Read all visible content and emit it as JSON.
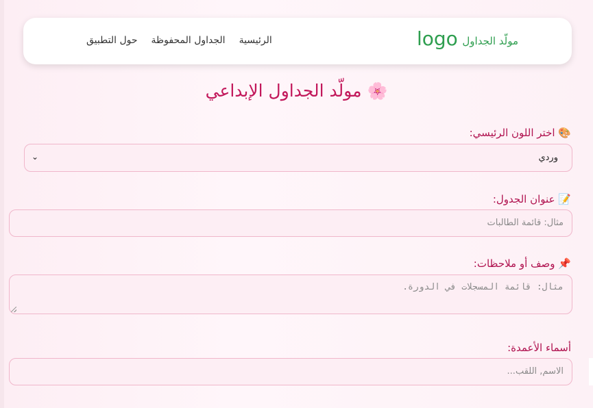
{
  "header": {
    "brand": "مولّد الجداول",
    "logo": "logo",
    "nav": [
      "الرئيسية",
      "الجداول المحفوظة",
      "حول التطبيق"
    ]
  },
  "title": {
    "icon": "🌸",
    "text": "مولّد الجداول الإبداعي"
  },
  "form": {
    "color": {
      "icon": "🎨",
      "label": "اختر اللون الرئيسي:",
      "selected": "وردي"
    },
    "table_title": {
      "icon": "📝",
      "label": "عنوان الجدول:",
      "placeholder": "مثال: قائمة الطالبات"
    },
    "notes": {
      "icon": "📌",
      "label": "وصف أو ملاحظات:",
      "placeholder": "مثال: قائمة المسجلات في الدورة."
    },
    "columns": {
      "label": "أسماء الأعمدة:",
      "placeholder": "الاسم, اللقب..."
    }
  },
  "colors": {
    "brand_green": "#2e9e4f",
    "accent_pink": "#c2185b",
    "field_bg": "#fdeef4",
    "field_border": "#f0b6ca"
  }
}
